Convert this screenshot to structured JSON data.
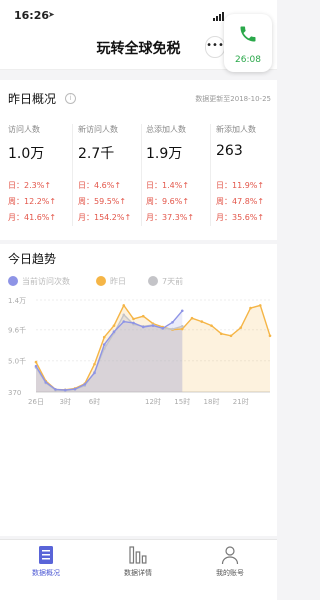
{
  "status_bar": {
    "time": "16:26",
    "location_icon": "location-arrow-icon"
  },
  "nav": {
    "title": "玩转全球免税",
    "more": "•••"
  },
  "call": {
    "duration": "26:08",
    "icon": "phone-icon",
    "color": "#2aa84a"
  },
  "overview": {
    "title": "昨日概况",
    "update_text": "数据更新至2018-10-25",
    "cards": [
      {
        "label": "访问人数",
        "value": "1.0万",
        "rows": [
          "日：2.3%↑",
          "周：12.2%↑",
          "月：41.6%↑"
        ]
      },
      {
        "label": "新访问人数",
        "value": "2.7千",
        "rows": [
          "日：4.6%↑",
          "周：59.5%↑",
          "月：154.2%↑"
        ]
      },
      {
        "label": "总添加人数",
        "value": "1.9万",
        "rows": [
          "日：1.4%↑",
          "周：9.6%↑",
          "月：37.3%↑"
        ]
      },
      {
        "label": "新添加人数",
        "value": "263",
        "rows": [
          "日：11.9%↑",
          "周：47.8%↑",
          "月：35.6%↑"
        ]
      }
    ],
    "up_color": "#e3564a"
  },
  "trend": {
    "title": "今日趋势",
    "legend": [
      {
        "label": "当前访问次数",
        "color": "#8e94e6"
      },
      {
        "label": "昨日",
        "color": "#f5b546"
      },
      {
        "label": "7天前",
        "color": "#c4c4c8"
      }
    ]
  },
  "chart_data": {
    "type": "line",
    "title": "",
    "x_ticks": [
      "26日",
      "3时",
      "6时",
      "12时",
      "15时",
      "18时",
      "21时"
    ],
    "y_ticks": [
      "1.4万",
      "9.6千",
      "5.0千",
      "370"
    ],
    "ylim": [
      370,
      14000
    ],
    "series": [
      {
        "name": "当前访问次数",
        "color": "#8e94e6",
        "values": [
          4200,
          1800,
          750,
          650,
          800,
          1500,
          3200,
          7400,
          9300,
          10800,
          10600,
          10000,
          10200,
          9800,
          10700,
          12400
        ]
      },
      {
        "name": "昨日",
        "color": "#f5b546",
        "values": [
          4800,
          2000,
          750,
          700,
          900,
          1600,
          4500,
          8500,
          10200,
          13200,
          11200,
          11600,
          10500,
          10000,
          9600,
          9700,
          11300,
          10800,
          10200,
          9000,
          8700,
          9900,
          12800,
          13200,
          8700
        ]
      },
      {
        "name": "7天前",
        "color": "#c4c4c8",
        "values": [
          4000,
          1700,
          650,
          600,
          750,
          1300,
          3300,
          6800,
          9100,
          11800,
          10400,
          10100,
          10300,
          9800,
          9700,
          10100
        ]
      }
    ]
  },
  "tabbar": {
    "tabs": [
      {
        "label": "数据概况",
        "icon": "document-list-icon",
        "active": true
      },
      {
        "label": "数据详情",
        "icon": "bar-chart-icon",
        "active": false
      },
      {
        "label": "我的账号",
        "icon": "user-icon",
        "active": false
      }
    ],
    "active_color": "#4f5bd5"
  }
}
